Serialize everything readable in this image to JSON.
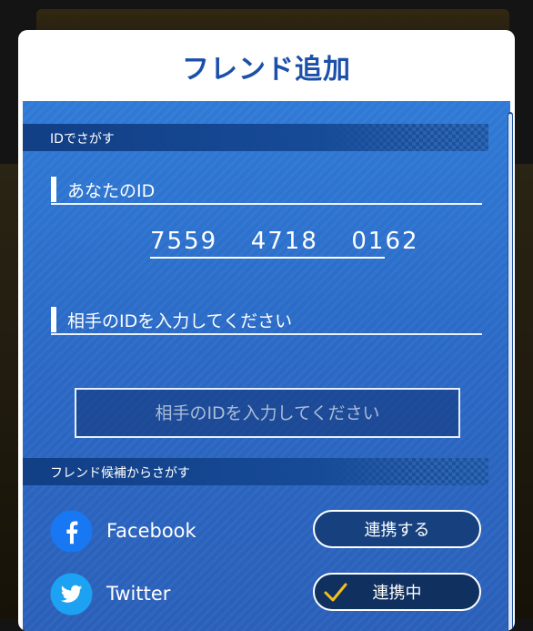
{
  "dialog": {
    "title": "フレンド追加"
  },
  "search_by_id": {
    "header": "IDでさがす",
    "your_id_label": "あなたのID",
    "your_id": "7559  4718  0162",
    "partner_id_label": "相手のIDを入力してください",
    "partner_id_placeholder": "相手のIDを入力してください"
  },
  "search_by_candidates": {
    "header": "フレンド候補からさがす",
    "facebook": {
      "name": "Facebook",
      "button": "連携する",
      "icon": "facebook-icon",
      "color": "#1877f2"
    },
    "twitter": {
      "name": "Twitter",
      "button": "連携中",
      "icon": "twitter-icon",
      "color": "#1da1f2",
      "check_color": "#f2c21b"
    }
  },
  "colors": {
    "title": "#1b4fa8",
    "panel": "#2a68c4",
    "header_band": "#123f86"
  }
}
